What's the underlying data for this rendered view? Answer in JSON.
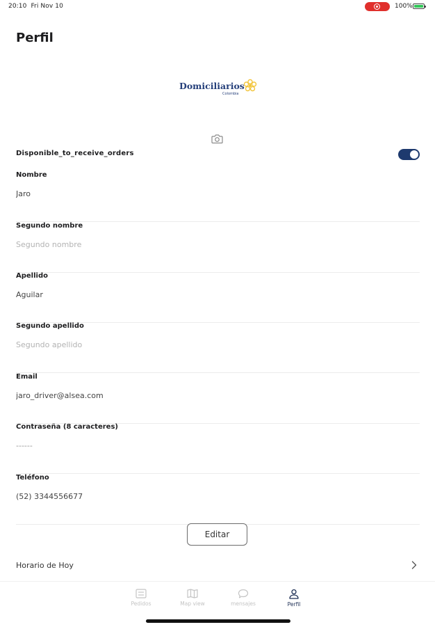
{
  "status_bar": {
    "time": "20:10",
    "date": "Fri Nov 10",
    "battery": "100%"
  },
  "page": {
    "title": "Perfil"
  },
  "logo": {
    "text": "Domiciliarios",
    "subtext": "Colombia"
  },
  "availability": {
    "label": "Disponible_to_receive_orders",
    "enabled": true
  },
  "fields": [
    {
      "label": "Nombre",
      "value": "Jaro",
      "placeholder": ""
    },
    {
      "label": "Segundo nombre",
      "value": "",
      "placeholder": "Segundo nombre"
    },
    {
      "label": "Apellido",
      "value": "Aguilar",
      "placeholder": ""
    },
    {
      "label": "Segundo apellido",
      "value": "",
      "placeholder": "Segundo apellido"
    },
    {
      "label": "Email",
      "value": "jaro_driver@alsea.com",
      "placeholder": ""
    },
    {
      "label": "Contraseña (8 caracteres)",
      "value": "------",
      "placeholder": ""
    },
    {
      "label": "Teléfono",
      "value": "(52) 3344556677",
      "placeholder": ""
    }
  ],
  "actions": {
    "edit_label": "Editar"
  },
  "schedule": {
    "label": "Horario de Hoy"
  },
  "tabs": [
    {
      "label": "Pedidos",
      "icon": "list-icon"
    },
    {
      "label": "Map view",
      "icon": "map-icon"
    },
    {
      "label": "mensajes",
      "icon": "chat-icon"
    },
    {
      "label": "Perfil",
      "icon": "person-icon"
    }
  ],
  "colors": {
    "accent": "#1e3a6e",
    "logo": "#253f7a",
    "logo_flower": "#f2c53d",
    "recording": "#e0302c"
  }
}
